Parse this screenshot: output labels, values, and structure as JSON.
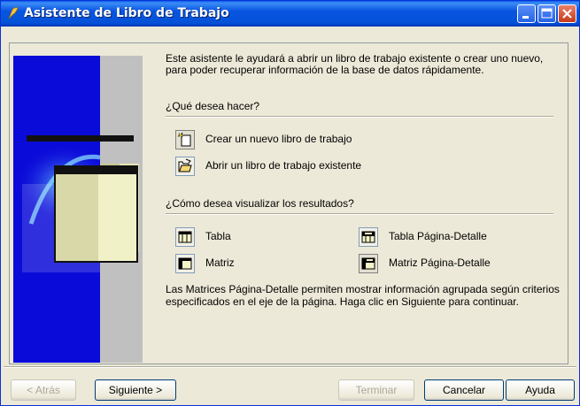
{
  "window": {
    "title": "Asistente de Libro de Trabajo",
    "colors": {
      "title_bar": "#0554e0",
      "face": "#ece9d8",
      "graphic_blue": "#0b0bd9",
      "graphic_gray": "#c0c0c0"
    }
  },
  "intro_text": "Este asistente le ayudará a abrir un libro de trabajo existente o crear uno nuevo, para poder recuperar información de la base de datos rápidamente.",
  "action_section": {
    "label": "¿Qué desea hacer?",
    "options": [
      {
        "label": "Crear un nuevo libro de trabajo",
        "icon": "new-workbook-icon",
        "selected": true
      },
      {
        "label": "Abrir un libro de trabajo existente",
        "icon": "open-folder-icon",
        "selected": false
      }
    ]
  },
  "view_section": {
    "label": "¿Cómo desea visualizar los resultados?",
    "options": [
      {
        "label": "Tabla",
        "icon": "table-icon",
        "selected": false
      },
      {
        "label": "Matriz",
        "icon": "matrix-icon",
        "selected": false
      },
      {
        "label": "Tabla Página-Detalle",
        "icon": "master-detail-table-icon",
        "selected": false
      },
      {
        "label": "Matriz Página-Detalle",
        "icon": "master-detail-matrix-icon",
        "selected": true
      }
    ]
  },
  "note_text": "Las Matrices Página-Detalle permiten mostrar información agrupada según criterios especificados en el eje de la página. Haga clic en Siguiente para continuar.",
  "buttons": {
    "back": "< Atrás",
    "next": "Siguiente >",
    "finish": "Terminar",
    "cancel": "Cancelar",
    "help": "Ayuda"
  }
}
